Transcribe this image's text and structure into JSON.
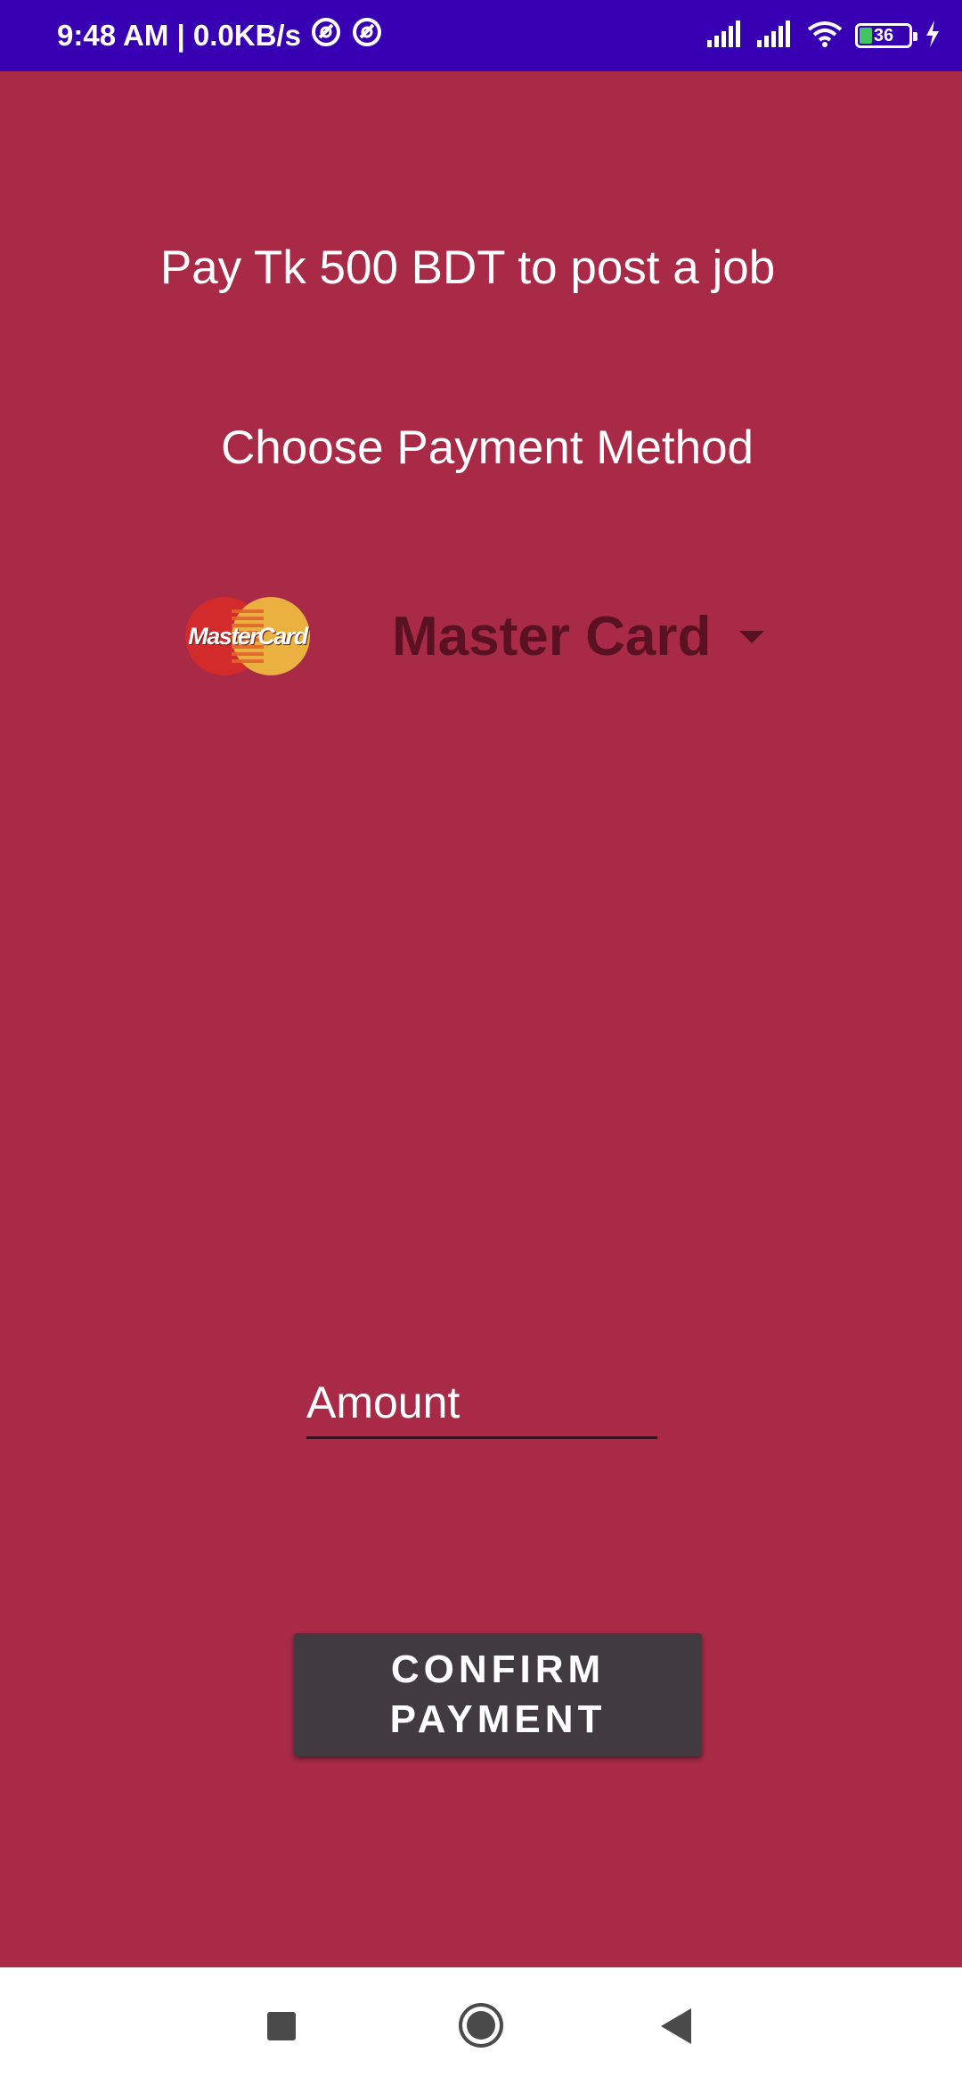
{
  "status_bar": {
    "time_speed": "9:48 AM | 0.0KB/s",
    "battery_level": "36",
    "icons": [
      "vpn-icon",
      "vpn-icon",
      "signal-icon",
      "signal-icon",
      "wifi-icon",
      "battery-icon",
      "charging-icon"
    ]
  },
  "header": {
    "pay_text": "Pay Tk 500 BDT to post a job",
    "choose_text": "Choose Payment Method"
  },
  "payment_method": {
    "logo_text": "MasterCard",
    "selected_label": "Master Card"
  },
  "amount_field": {
    "placeholder": "Amount",
    "value": ""
  },
  "confirm_button": {
    "label": "CONFIRM PAYMENT"
  },
  "colors": {
    "background": "#a82a47",
    "status_bar": "#3700b3",
    "button": "#413b3f",
    "method_label": "#5a1222"
  }
}
